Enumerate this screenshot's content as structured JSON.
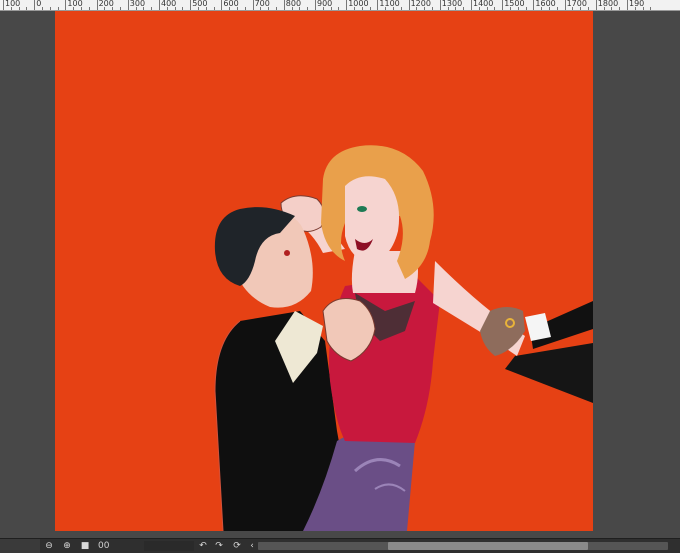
{
  "ruler": {
    "labels": [
      "100",
      "0",
      "100",
      "200",
      "300",
      "400",
      "500",
      "600",
      "700",
      "800",
      "900",
      "1000",
      "1100",
      "1200",
      "1300",
      "1400",
      "1500",
      "1600",
      "1700",
      "1800",
      "190"
    ]
  },
  "canvas": {
    "background": "#e64114"
  },
  "statusbar": {
    "zoom_value": "00",
    "zoom_out_icon": "zoom-out-icon",
    "zoom_in_icon": "zoom-in-icon",
    "fit_icon": "fit-screen-icon",
    "rotate_left_icon": "rotate-left-icon",
    "rotate_right_icon": "rotate-right-icon",
    "reset_icon": "reset-rotation-icon",
    "nav_left_icon": "chevron-left-icon"
  },
  "colors": {
    "workspace": "#484848",
    "statusbar": "#2f2f2f",
    "ruler": "#f2f2f2"
  }
}
